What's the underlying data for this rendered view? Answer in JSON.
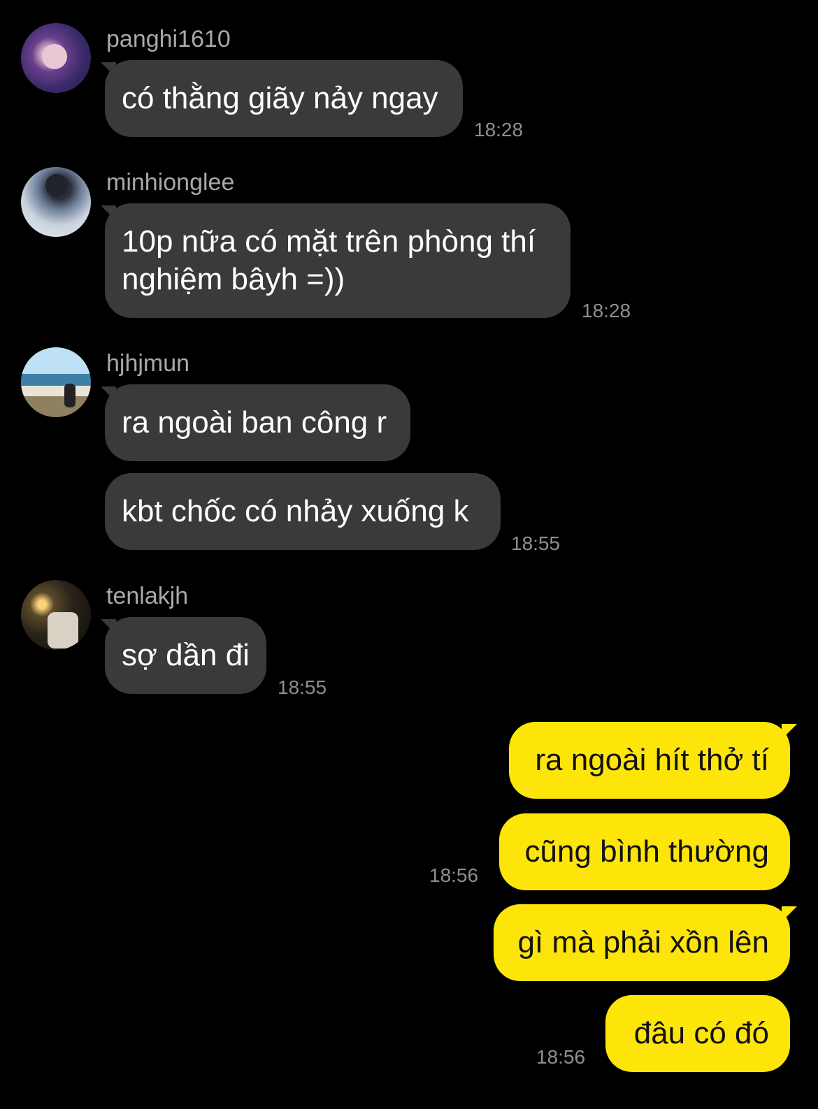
{
  "messages": [
    {
      "sender": "panghi1610",
      "avatar_icon": "user-avatar-icon",
      "bubbles": [
        "có thằng giãy nảy ngay"
      ],
      "time": "18:28"
    },
    {
      "sender": "minhionglee",
      "avatar_icon": "user-avatar-icon",
      "bubbles": [
        "10p nữa có mặt trên phòng thí nghiệm bâyh =))"
      ],
      "time": "18:28"
    },
    {
      "sender": "hjhjmun",
      "avatar_icon": "user-avatar-icon",
      "bubbles": [
        "ra ngoài ban công r",
        "kbt chốc có nhảy xuống k"
      ],
      "time": "18:55"
    },
    {
      "sender": "tenlakjh",
      "avatar_icon": "user-avatar-icon",
      "bubbles": [
        "sợ dần đi"
      ],
      "time": "18:55"
    }
  ],
  "my_messages": [
    {
      "bubbles": [
        "ra ngoài hít thở tí",
        "cũng bình thường"
      ],
      "time": "18:56"
    },
    {
      "bubbles": [
        "gì mà phải xồn lên",
        "đâu có đó"
      ],
      "time": "18:56"
    }
  ],
  "colors": {
    "received_bubble": "#3a3a3c",
    "sent_bubble": "#fde50a",
    "background": "#000000"
  }
}
